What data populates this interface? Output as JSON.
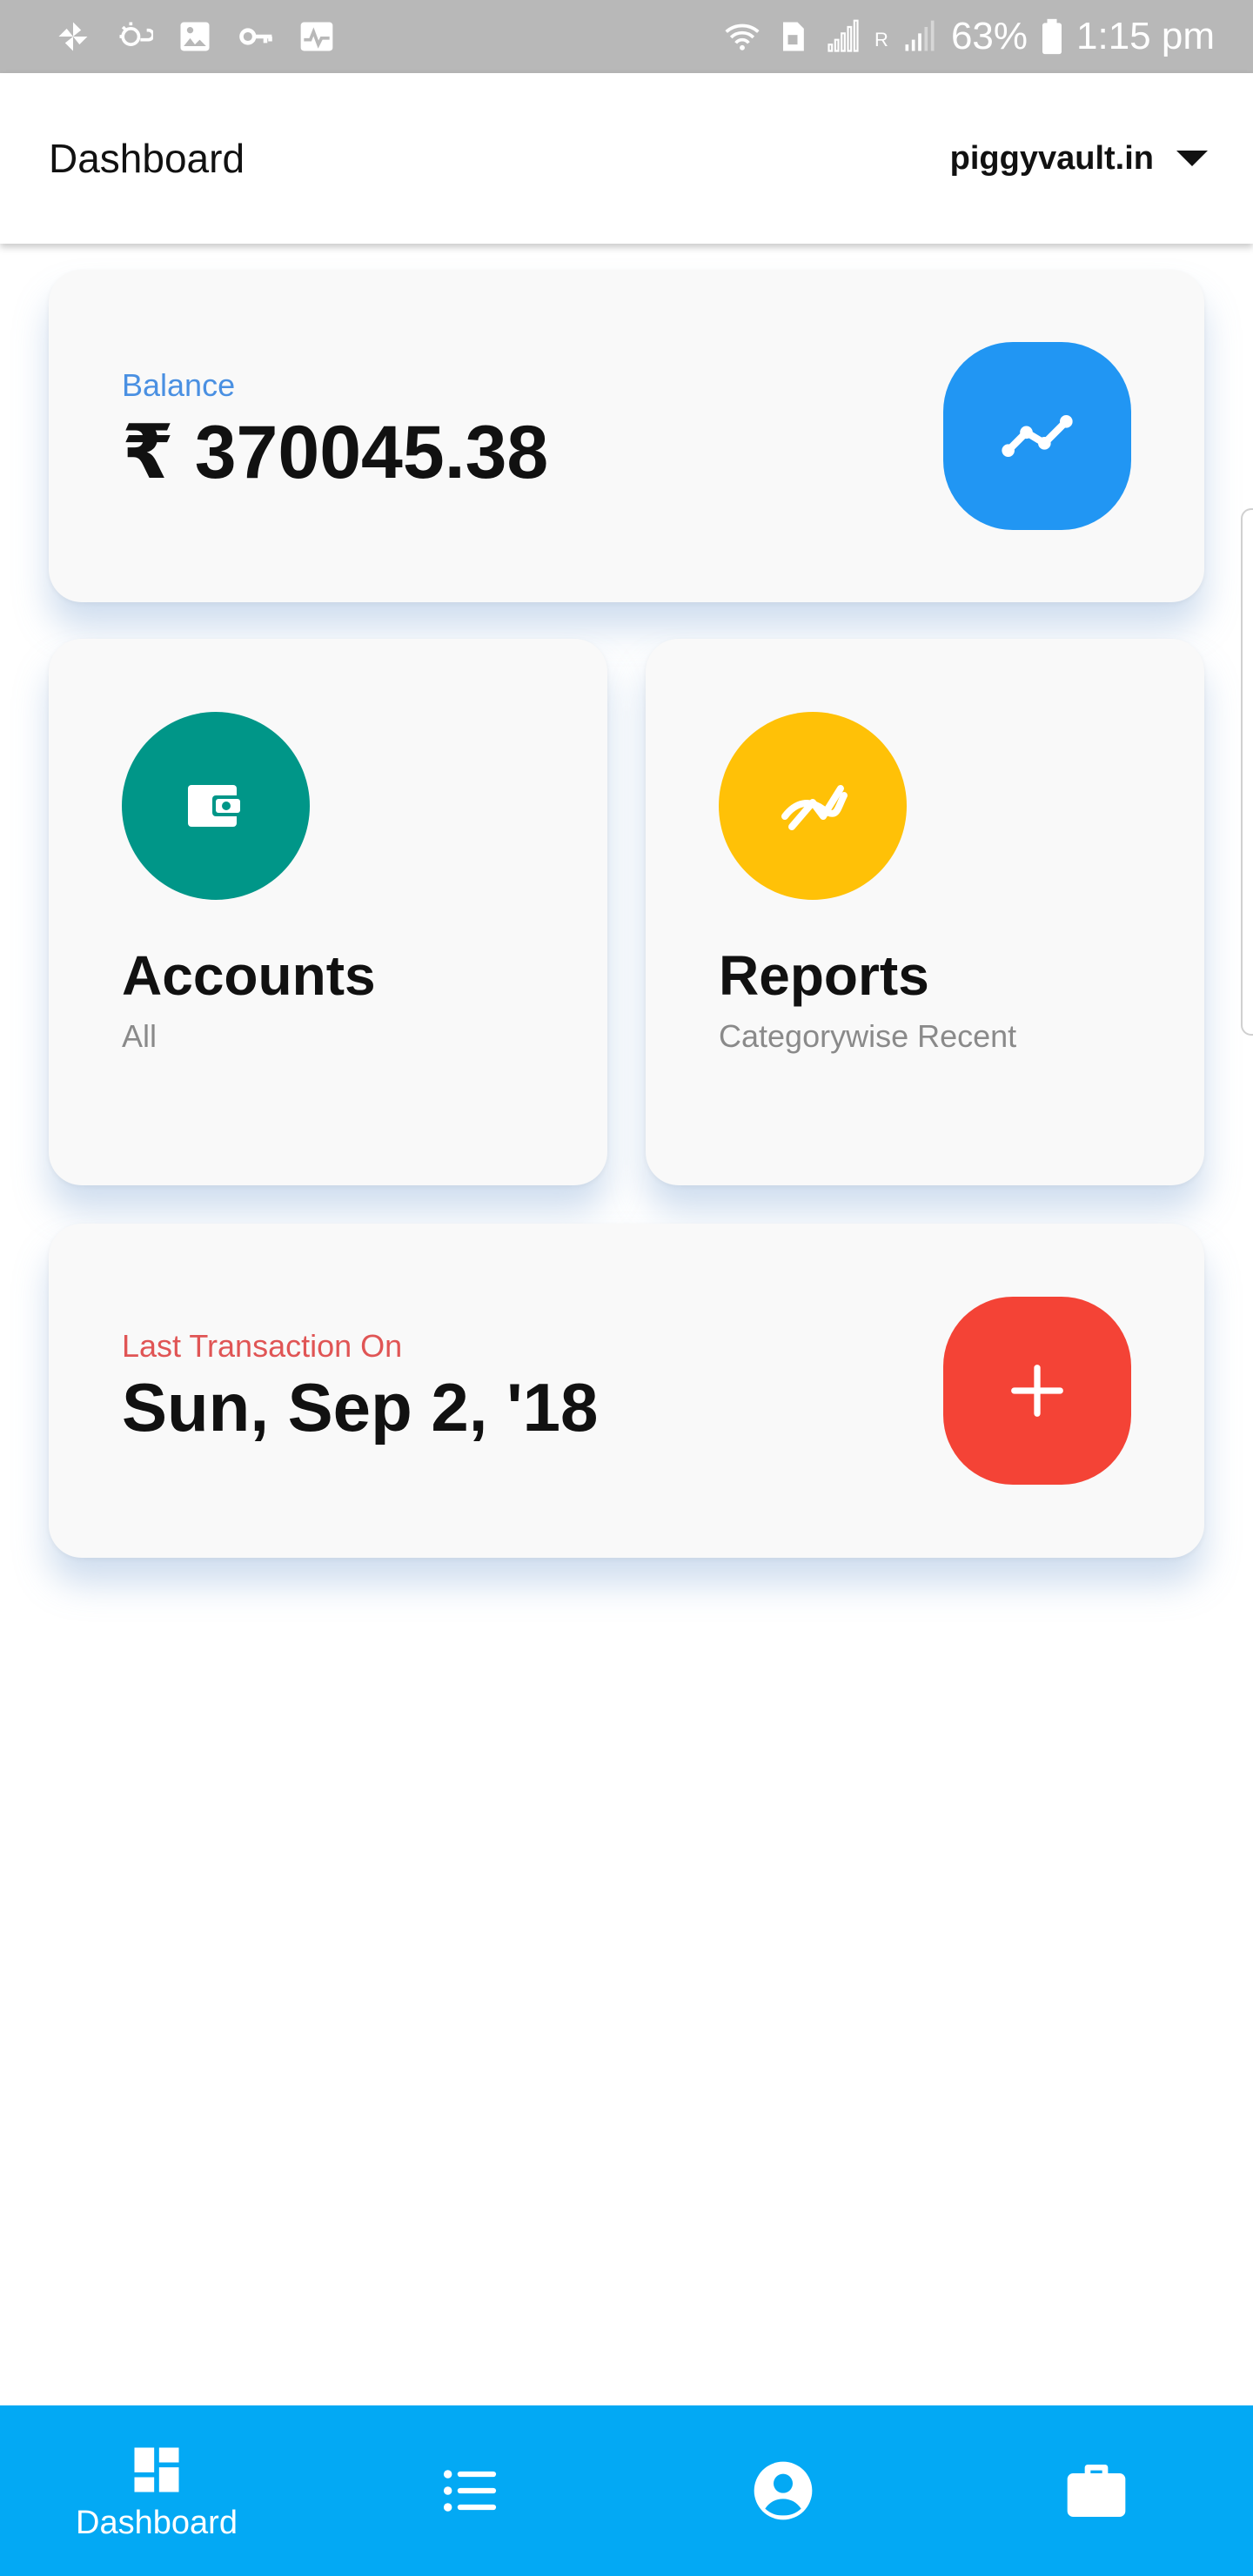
{
  "status_bar": {
    "battery": "63%",
    "time": "1:15 pm",
    "network_label": "R"
  },
  "app_bar": {
    "title": "Dashboard",
    "account": "piggyvault.in"
  },
  "balance_card": {
    "label": "Balance",
    "value": "₹ 370045.38",
    "label_color": "#4a90e2",
    "button_color": "#2196f3"
  },
  "accounts_card": {
    "title": "Accounts",
    "subtitle": "All",
    "icon_color": "#009688"
  },
  "reports_card": {
    "title": "Reports",
    "subtitle": "Categorywise Recent",
    "icon_color": "#ffc107"
  },
  "last_transaction_card": {
    "label": "Last Transaction On",
    "value": "Sun, Sep 2, '18",
    "label_color": "#e05555",
    "button_color": "#f44336"
  },
  "bottom_nav": {
    "background": "#03a9f4",
    "items": [
      {
        "label": "Dashboard",
        "icon": "dashboard-icon"
      },
      {
        "label": "",
        "icon": "list-icon"
      },
      {
        "label": "",
        "icon": "account-circle-icon"
      },
      {
        "label": "",
        "icon": "briefcase-icon"
      }
    ]
  }
}
